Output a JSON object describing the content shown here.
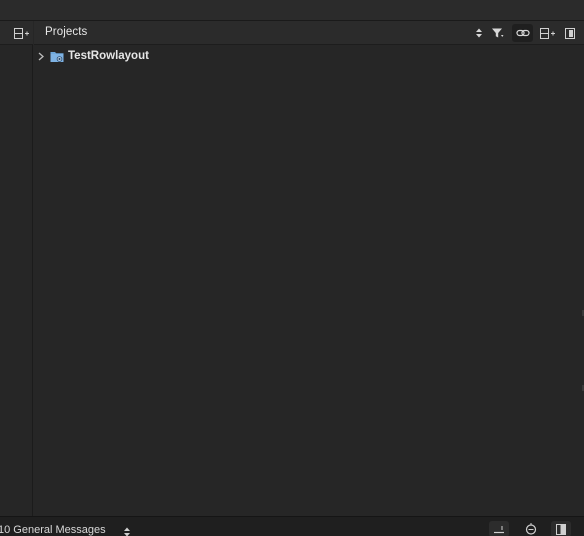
{
  "projects_panel": {
    "title": "Projects",
    "icons": {
      "sort": "stepper-arrows-icon",
      "filter": "filter-icon",
      "link": "link-icon",
      "split": "split-add-icon",
      "close": "close-pane-icon"
    }
  },
  "left_panel": {
    "icons": {
      "split": "split-add-icon"
    }
  },
  "tree": {
    "items": [
      {
        "label": "TestRowlayout",
        "icon": "project-folder-icon",
        "expanded": false
      }
    ]
  },
  "status_bar": {
    "messages_label": "10 General Messages",
    "icons": {
      "selector": "stepper-arrows-icon",
      "console": "console-icon",
      "debug": "debug-icon",
      "panel": "panel-toggle-icon"
    }
  },
  "colors": {
    "background": "#262626",
    "header": "#2b2b2b",
    "status_bar": "#1f1f1f",
    "folder_blue": "#6fa8dc",
    "text": "#e8e8e8"
  }
}
